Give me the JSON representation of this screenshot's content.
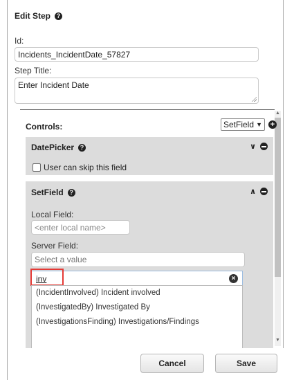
{
  "dialog": {
    "title": "Edit Step",
    "help_glyph": "?"
  },
  "fields": {
    "id_label": "Id:",
    "id_value": "Incidents_IncidentDate_57827",
    "step_title_label": "Step Title:",
    "step_title_value": "Enter Incident Date"
  },
  "controls": {
    "label": "Controls:",
    "selected_type": "SetField",
    "add_glyph": "+"
  },
  "panels": {
    "datepicker": {
      "title": "DatePicker",
      "collapse_glyph": "∨",
      "skip_label": "User can skip this field"
    },
    "setfield": {
      "title": "SetField",
      "collapse_glyph": "∧",
      "local_field_label": "Local Field:",
      "local_field_placeholder": "<enter local name>",
      "server_field_label": "Server Field:",
      "server_field_placeholder": "Select a value",
      "search_value": "inv",
      "clear_glyph": "×",
      "options": [
        "(IncidentInvolved) Incident involved",
        "(InvestigatedBy) Investigated By",
        "(InvestigationsFinding) Investigations/Findings"
      ]
    }
  },
  "footer": {
    "cancel_label": "Cancel",
    "save_label": "Save"
  },
  "colors": {
    "panel_bg": "#dcdcdc",
    "highlight_border": "#e53935",
    "search_border": "#9bbce0"
  },
  "icons": [
    "help-icon",
    "add-circle-icon",
    "chevron-down-icon",
    "chevron-up-icon",
    "remove-circle-icon",
    "clear-search-icon",
    "resize-grip-icon"
  ]
}
